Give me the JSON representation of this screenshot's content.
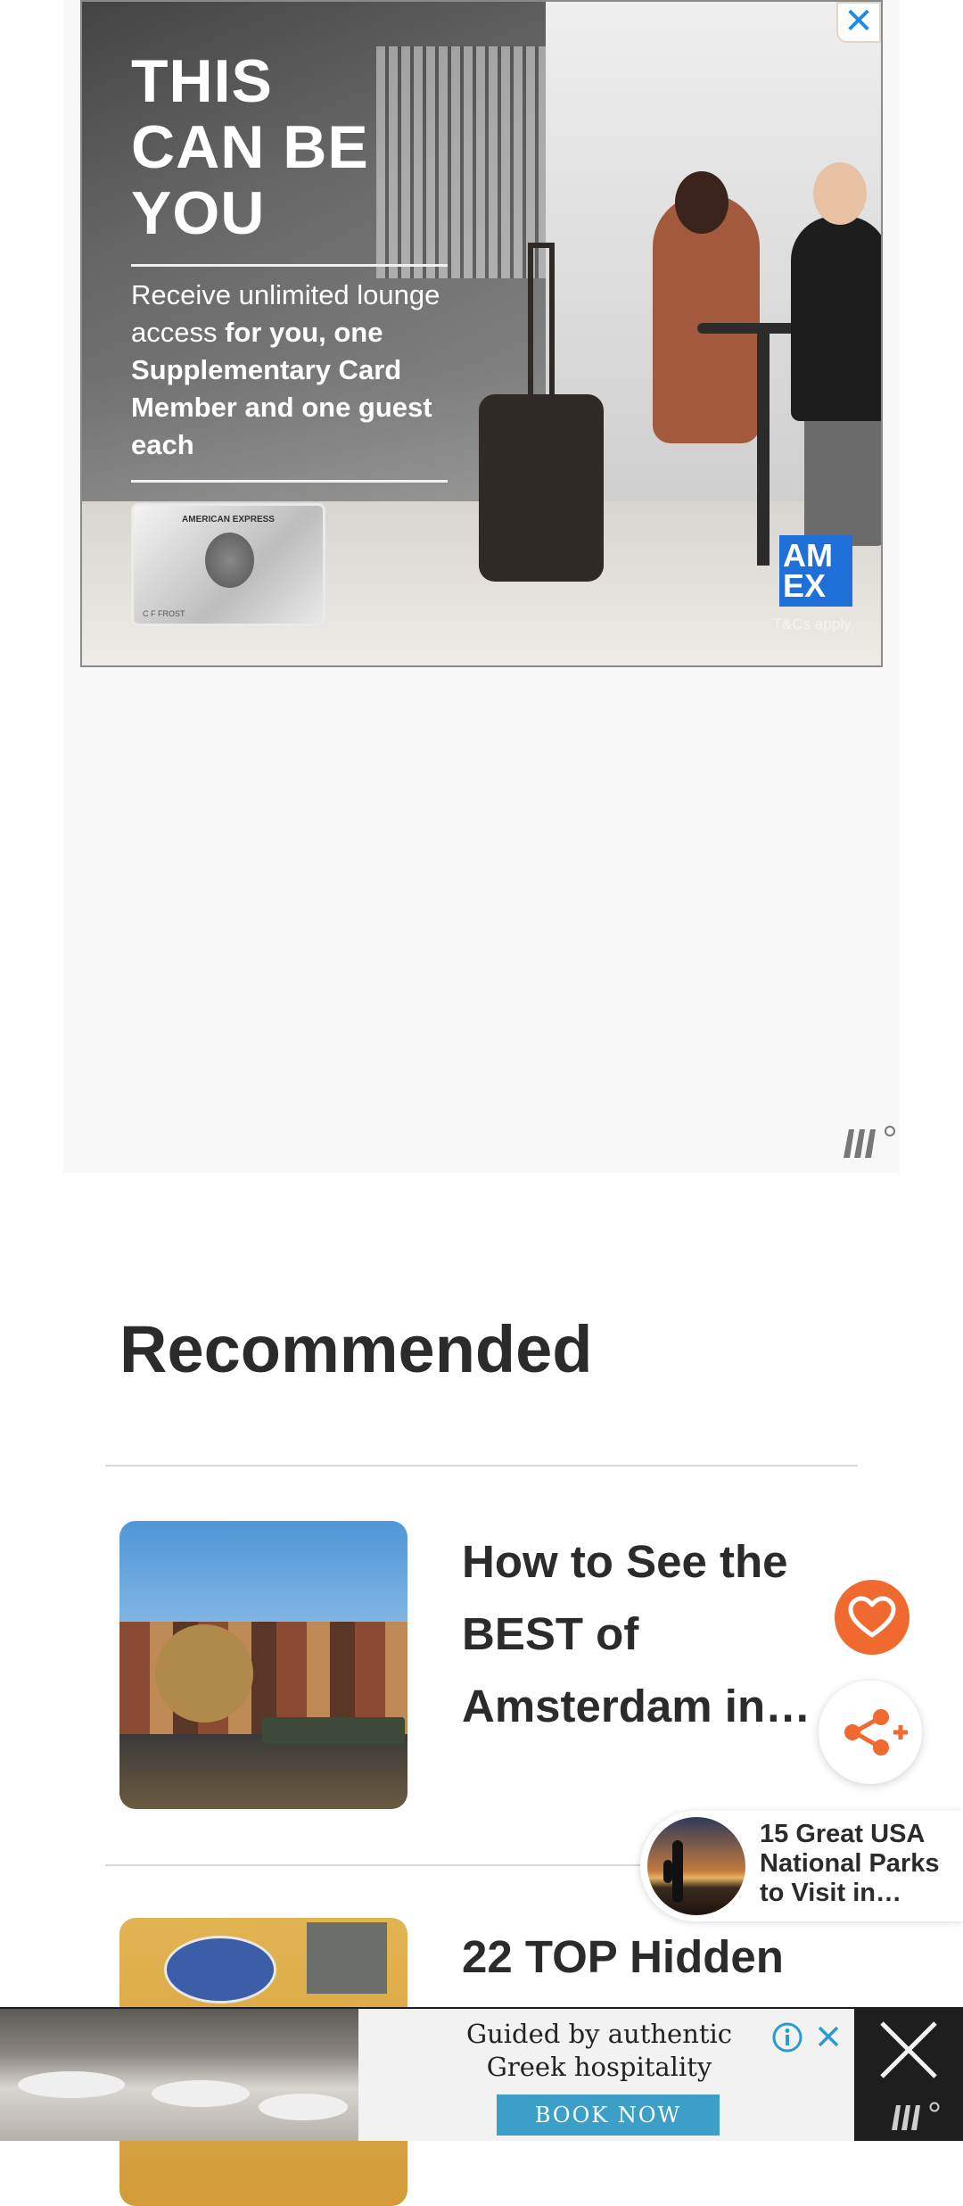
{
  "top_ad": {
    "headline": "THIS\nCAN BE\nYOU",
    "body_light": "Receive unlimited lounge access",
    "body_bold": " for you, one Supplementary Card Member and one guest each",
    "card_title": "AMERICAN EXPRESS",
    "card_name": "C F FROST",
    "brand_logo": "AM\nEX",
    "tcs": "T&Cs apply.",
    "close_label": "✕",
    "close_color": "#1e8be0",
    "amex_blue": "#1f6fd8"
  },
  "recommended": {
    "title": "Recommended",
    "items": [
      {
        "title": "How to See the BEST of Amsterdam in…"
      },
      {
        "title": "22 TOP Hidden"
      }
    ]
  },
  "floating": {
    "favorite_icon": "heart-icon",
    "favorite_color": "#f06a2f",
    "share_icon": "share-plus-icon"
  },
  "slide_in": {
    "title": "15 Great USA National Parks to Visit in…"
  },
  "bottom_ad": {
    "copy": "Guided by authentic Greek hospitality",
    "cta": "BOOK NOW",
    "cta_color": "#3d9ec7",
    "info_icon": "info-icon",
    "close_icon": "close-icon"
  }
}
